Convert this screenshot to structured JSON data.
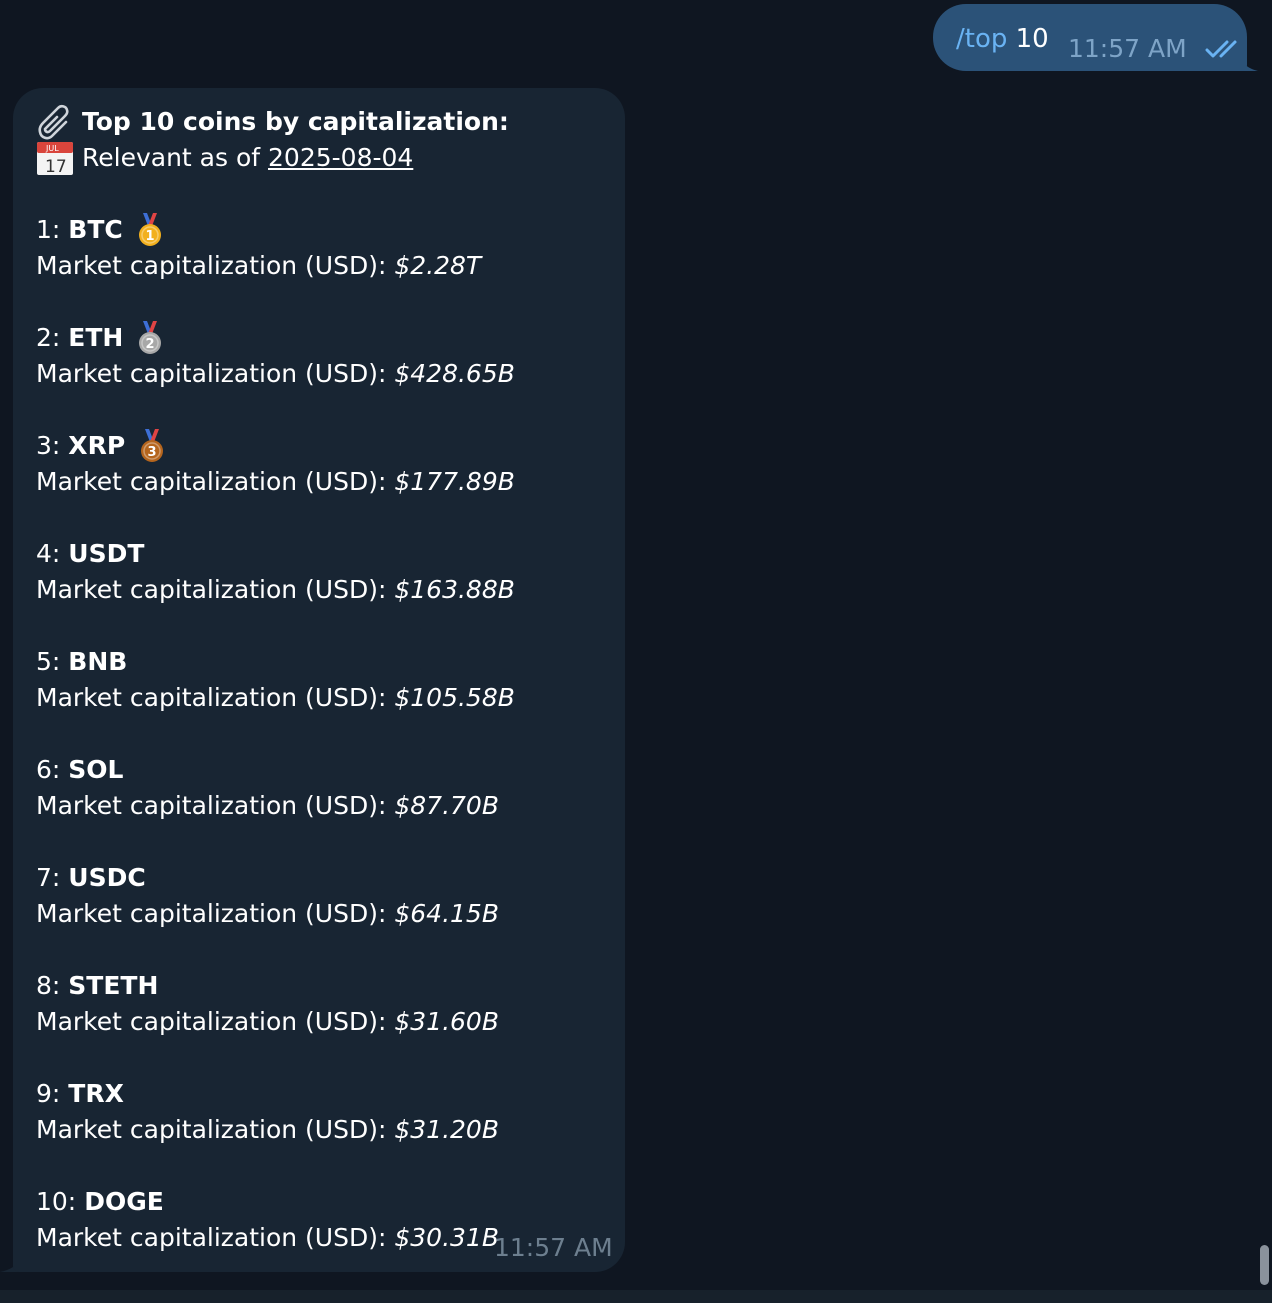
{
  "outgoing": {
    "command": "/top",
    "argument": "10",
    "time": "11:57 AM",
    "status_icon": "double-check-icon"
  },
  "incoming": {
    "title_icon": "paperclip-icon",
    "title": "Top 10 coins by capitalization:",
    "date_icon": "calendar-icon",
    "calendar_month": "JUL",
    "calendar_day": "17",
    "relevant_prefix": "Relevant as of ",
    "relevant_date": "2025-08-04",
    "time": "11:57 AM",
    "coins": [
      {
        "rank": "1:",
        "symbol": "BTC",
        "medal": "gold-medal-icon",
        "medal_number": "1",
        "label": "Market capitalization (USD):",
        "value": "$2.28T"
      },
      {
        "rank": "2:",
        "symbol": "ETH",
        "medal": "silver-medal-icon",
        "medal_number": "2",
        "label": "Market capitalization (USD):",
        "value": "$428.65B"
      },
      {
        "rank": "3:",
        "symbol": "XRP",
        "medal": "bronze-medal-icon",
        "medal_number": "3",
        "label": "Market capitalization (USD):",
        "value": "$177.89B"
      },
      {
        "rank": "4:",
        "symbol": "USDT",
        "label": "Market capitalization (USD):",
        "value": "$163.88B"
      },
      {
        "rank": "5:",
        "symbol": "BNB",
        "label": "Market capitalization (USD):",
        "value": "$105.58B"
      },
      {
        "rank": "6:",
        "symbol": "SOL",
        "label": "Market capitalization (USD):",
        "value": "$87.70B"
      },
      {
        "rank": "7:",
        "symbol": "USDC",
        "label": "Market capitalization (USD):",
        "value": "$64.15B"
      },
      {
        "rank": "8:",
        "symbol": "STETH",
        "label": "Market capitalization (USD):",
        "value": "$31.60B"
      },
      {
        "rank": "9:",
        "symbol": "TRX",
        "label": "Market capitalization (USD):",
        "value": "$31.20B"
      },
      {
        "rank": "10:",
        "symbol": "DOGE",
        "label": "Market capitalization (USD):",
        "value": "$30.31B"
      }
    ]
  },
  "colors": {
    "background": "#0f1621",
    "outgoing_bubble": "#2b5278",
    "incoming_bubble": "#182533",
    "command_link": "#6ab3f3",
    "gold": "#f2b01e",
    "silver": "#a8a8a8",
    "bronze": "#b5651d"
  }
}
